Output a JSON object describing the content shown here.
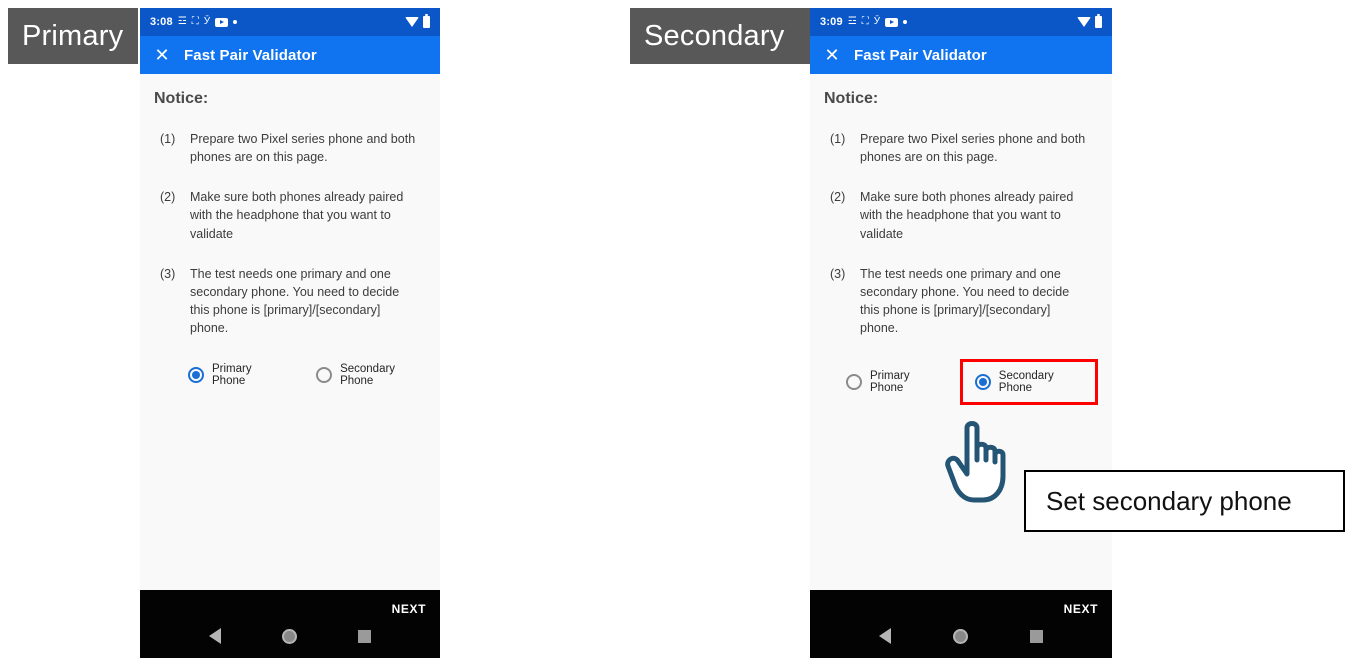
{
  "annotations": {
    "primary_label": "Primary",
    "secondary_label": "Secondary",
    "callout_text": "Set secondary phone"
  },
  "phones": [
    {
      "id": "primary",
      "statusbar": {
        "time": "3:08",
        "icons": [
          "snapchat-icon",
          "gmail-icon",
          "y-app-icon",
          "youtube-icon",
          "dot-icon"
        ],
        "wifi": "wifi-icon",
        "battery": "battery-icon"
      },
      "appbar": {
        "close": "✕",
        "title": "Fast Pair Validator"
      },
      "notice": {
        "heading": "Notice:",
        "items": [
          {
            "num": "(1)",
            "text": "Prepare two Pixel series phone and both phones are on this page."
          },
          {
            "num": "(2)",
            "text": "Make sure both phones already paired with the headphone that you want to validate"
          },
          {
            "num": "(3)",
            "text": "The test needs one primary and one secondary phone. You need to decide this phone is [primary]/[secondary] phone."
          }
        ]
      },
      "radio": {
        "primary_label": "Primary Phone",
        "secondary_label": "Secondary Phone",
        "selected": "primary"
      },
      "navbar": {
        "next_label": "NEXT",
        "back": "back-icon",
        "home": "home-icon",
        "recents": "recents-icon"
      }
    },
    {
      "id": "secondary",
      "statusbar": {
        "time": "3:09",
        "icons": [
          "snapchat-icon",
          "gmail-icon",
          "y-app-icon",
          "youtube-icon",
          "dot-icon"
        ],
        "wifi": "wifi-icon",
        "battery": "battery-icon"
      },
      "appbar": {
        "close": "✕",
        "title": "Fast Pair Validator"
      },
      "notice": {
        "heading": "Notice:",
        "items": [
          {
            "num": "(1)",
            "text": "Prepare two Pixel series phone and both phones are on this page."
          },
          {
            "num": "(2)",
            "text": "Make sure both phones already paired with the headphone that you want to validate"
          },
          {
            "num": "(3)",
            "text": "The test needs one primary and one secondary phone. You need to decide this phone is [primary]/[secondary] phone."
          }
        ]
      },
      "radio": {
        "primary_label": "Primary Phone",
        "secondary_label": "Secondary Phone",
        "selected": "secondary"
      },
      "navbar": {
        "next_label": "NEXT",
        "back": "back-icon",
        "home": "home-icon",
        "recents": "recents-icon"
      }
    }
  ],
  "colors": {
    "statusbar_blue": "#0b57c8",
    "appbar_blue": "#1073ef",
    "accent_blue": "#1a6fd4",
    "highlight_red": "#ff0000",
    "chip_gray": "#585858",
    "cursor_navy": "#1f5170"
  }
}
